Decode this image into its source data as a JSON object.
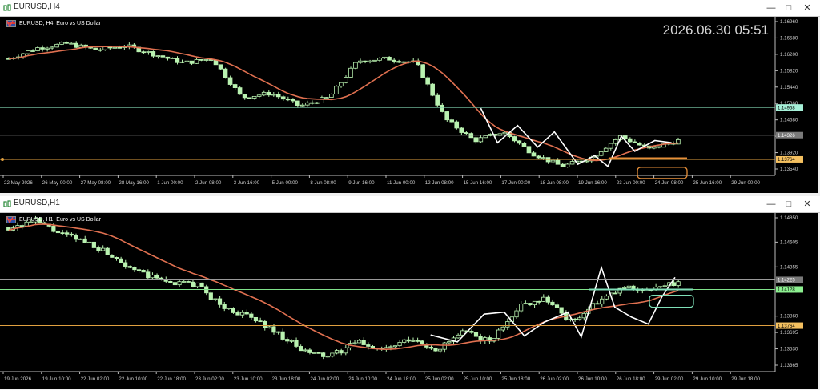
{
  "top": {
    "title": "EURUSD,H4",
    "symbol_label": "EURUSD, H4:  Euro vs US Dollar",
    "clock": "2026.06.30 05:51",
    "y_ticks": [
      "1.16960",
      "1.16580",
      "1.16200",
      "1.15820",
      "1.15440",
      "1.15060",
      "1.14680",
      "1.14300",
      "1.13920",
      "1.13540"
    ],
    "x_ticks": [
      "22 May 2026",
      "26 May 00:00",
      "27 May 08:00",
      "28 May 16:00",
      "1 Jun 00:00",
      "2 Jun 08:00",
      "3 Jun 16:00",
      "5 Jun 00:00",
      "8 Jun 08:00",
      "9 Jun 16:00",
      "11 Jun 00:00",
      "12 Jun 08:00",
      "15 Jun 16:00",
      "17 Jun 00:00",
      "18 Jun 08:00",
      "19 Jun 16:00",
      "23 Jun 00:00",
      "24 Jun 08:00",
      "25 Jun 16:00",
      "29 Jun 00:00"
    ],
    "hlines": [
      {
        "price": 1.14968,
        "label": "1.14968",
        "color": "#7fd4b0",
        "badge_bg": "#a6f0d8",
        "badge_fg": "#000000"
      },
      {
        "price": 1.14326,
        "label": "1.14326",
        "color": "#9a9a9a",
        "badge_bg": "#7a7a7a",
        "badge_fg": "#ffffff"
      },
      {
        "price": 1.13764,
        "label": "1.13764",
        "color": "#e0a040",
        "badge_bg": "#f4c060",
        "badge_fg": "#000000"
      }
    ]
  },
  "bottom": {
    "title": "EURUSD,H1",
    "symbol_label": "EURUSD, H1:  Euro vs US Dollar",
    "y_ticks": [
      "1.14850",
      "1.14605",
      "1.14355",
      "1.14110",
      "1.13860",
      "1.13695",
      "1.13530",
      "1.13365"
    ],
    "x_ticks": [
      "19 Jun 2026",
      "19 Jun 10:00",
      "22 Jun 02:00",
      "22 Jun 10:00",
      "22 Jun 18:00",
      "23 Jun 02:00",
      "23 Jun 10:00",
      "23 Jun 18:00",
      "24 Jun 02:00",
      "24 Jun 10:00",
      "24 Jun 18:00",
      "25 Jun 02:00",
      "25 Jun 10:00",
      "25 Jun 18:00",
      "26 Jun 02:00",
      "26 Jun 10:00",
      "26 Jun 18:00",
      "29 Jun 02:00",
      "29 Jun 10:00",
      "29 Jun 18:00"
    ],
    "hlines": [
      {
        "price": 1.14225,
        "label": "1.14225",
        "color": "#9a9a9a",
        "badge_bg": "#7a7a7a",
        "badge_fg": "#ffffff"
      },
      {
        "price": 1.14128,
        "label": "1.14128",
        "color": "#7fe08a",
        "badge_bg": "#8cf090",
        "badge_fg": "#000000"
      },
      {
        "price": 1.13764,
        "label": "1.13764",
        "color": "#e0a040",
        "badge_bg": "#f4c060",
        "badge_fg": "#000000"
      }
    ]
  },
  "colors": {
    "bull": "#b9f2b0",
    "bear": "#b9f2b0",
    "ma": "#e07050",
    "zigzag": "#ffffff",
    "grid": "#202020"
  },
  "icons": {
    "window_icon": "chart-icon",
    "minimize": "minimize-icon",
    "maximize": "maximize-icon",
    "close": "close-icon"
  }
}
